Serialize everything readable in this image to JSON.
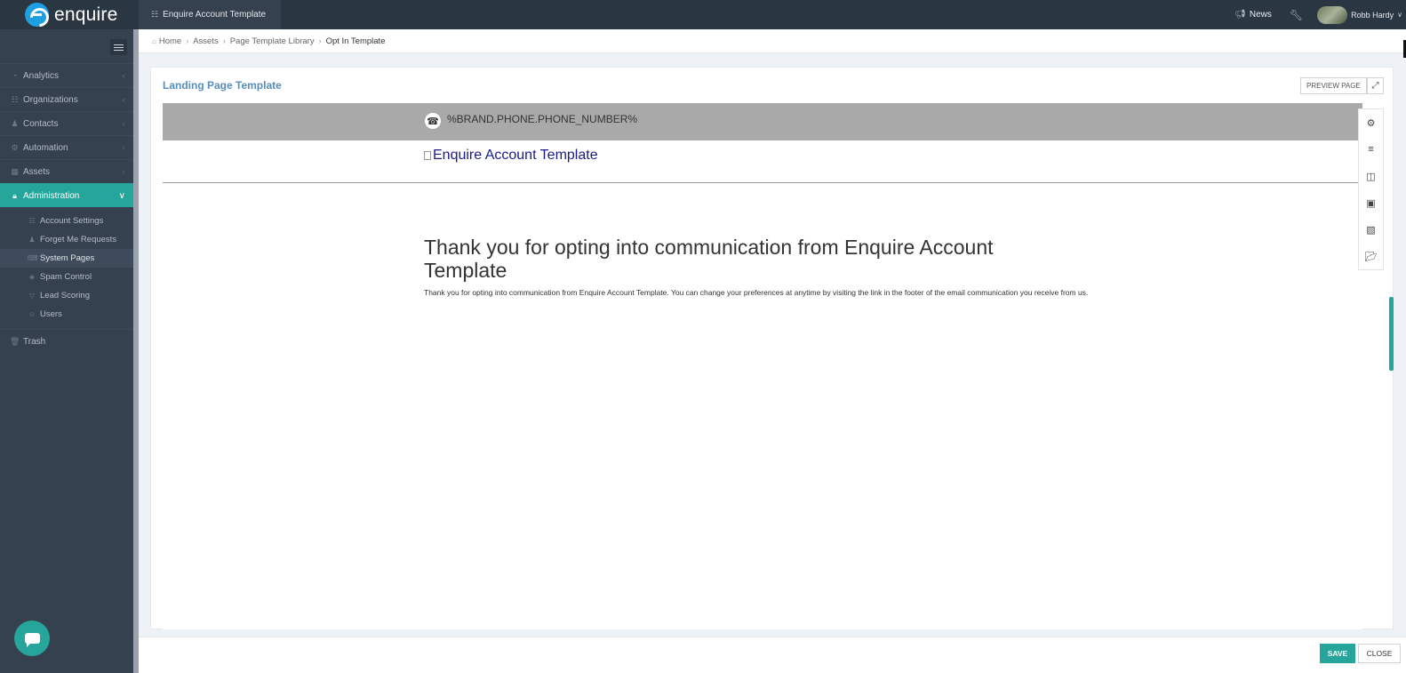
{
  "topbar": {
    "logo_text": "enquire",
    "account_tab": "Enquire Account Template",
    "news_label": "News",
    "user_name": "Robb Hardy"
  },
  "sidebar": {
    "items": [
      {
        "label": "Analytics",
        "icon": "dashboard-icon"
      },
      {
        "label": "Organizations",
        "icon": "sitemap-icon"
      },
      {
        "label": "Contacts",
        "icon": "users-icon"
      },
      {
        "label": "Automation",
        "icon": "cogs-icon"
      },
      {
        "label": "Assets",
        "icon": "grid-icon"
      },
      {
        "label": "Administration",
        "icon": "lock-icon"
      }
    ],
    "admin_subitems": [
      {
        "label": "Account Settings",
        "icon": "sitemap-icon"
      },
      {
        "label": "Forget Me Requests",
        "icon": "user-minus-icon"
      },
      {
        "label": "System Pages",
        "icon": "keyboard-icon"
      },
      {
        "label": "Spam Control",
        "icon": "shield-icon"
      },
      {
        "label": "Lead Scoring",
        "icon": "filter-icon"
      },
      {
        "label": "Users",
        "icon": "user-icon"
      }
    ],
    "trash_label": "Trash"
  },
  "breadcrumb": {
    "items": [
      "Home",
      "Assets",
      "Page Template Library",
      "Opt In Template"
    ]
  },
  "portlet": {
    "title": "Landing Page Template",
    "preview_label": "PREVIEW PAGE"
  },
  "canvas": {
    "phone_placeholder": "%BRAND.PHONE.PHONE_NUMBER%",
    "logo_alt": "Enquire Account Template",
    "heading": "Thank you for opting into communication from Enquire Account Template",
    "body": "Thank you for opting into communication from Enquire Account Template. You can change your preferences at anytime by visiting the link in the footer of the email communication you receive from us."
  },
  "tools": [
    "gear-icon",
    "sliders-icon",
    "columns-icon",
    "image-frame-icon",
    "image-icon",
    "folder-open-icon"
  ],
  "footer": {
    "save_label": "SAVE",
    "close_label": "CLOSE"
  },
  "colors": {
    "sidebar_bg": "#364150",
    "topbar_bg": "#2b3643",
    "accent": "#26a69a",
    "title_blue": "#578ebe",
    "phone_band": "#a9a9a9"
  }
}
